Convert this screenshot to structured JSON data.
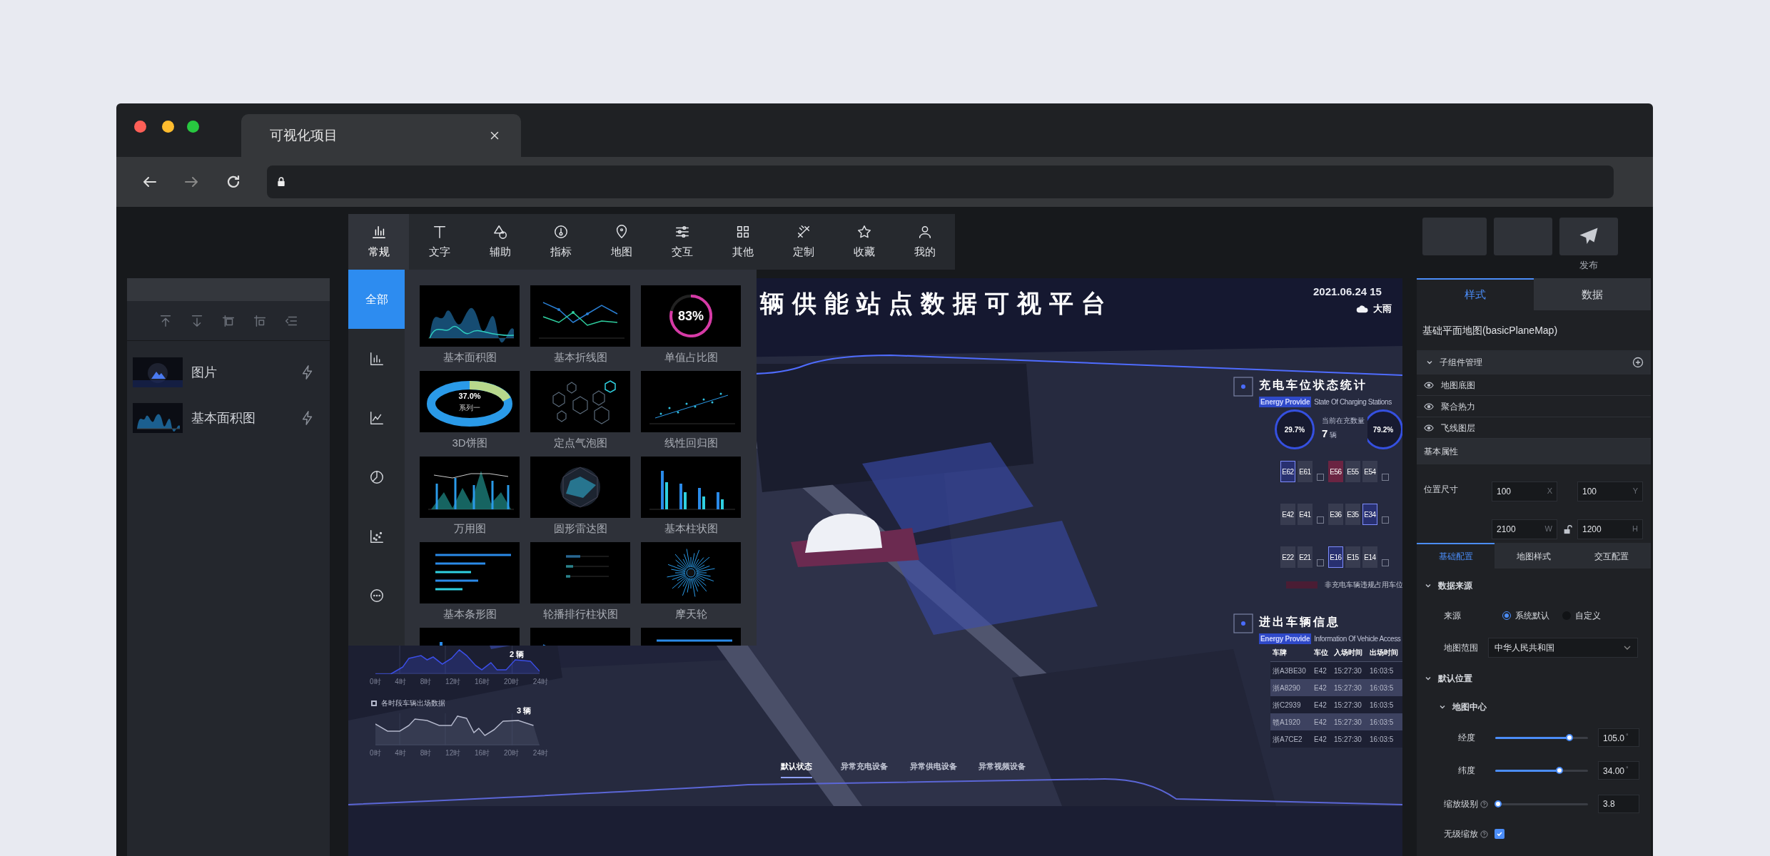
{
  "browser": {
    "tab_title": "可视化项目"
  },
  "toolbar": {
    "buttons": [
      {
        "kind": "blank"
      },
      {
        "kind": "blank"
      },
      {
        "kind": "publish",
        "label": "发布"
      }
    ]
  },
  "layers_panel": {
    "layers": [
      {
        "name": "图片"
      },
      {
        "name": "基本面积图",
        "kind": "area"
      }
    ]
  },
  "component_picker": {
    "tabs": [
      {
        "label": "常规",
        "kind": "common",
        "selected": true
      },
      {
        "label": "文字",
        "kind": "text",
        "selected": false
      },
      {
        "label": "辅助",
        "kind": "assist",
        "selected": false
      },
      {
        "label": "指标",
        "kind": "metric",
        "selected": false
      },
      {
        "label": "地图",
        "kind": "map",
        "selected": false
      },
      {
        "label": "交互",
        "kind": "interact",
        "selected": false
      },
      {
        "label": "其他",
        "kind": "other",
        "selected": false
      },
      {
        "label": "定制",
        "kind": "custom",
        "selected": false
      },
      {
        "label": "收藏",
        "kind": "favorite",
        "selected": false
      },
      {
        "label": "我的",
        "kind": "mine",
        "selected": false
      }
    ],
    "categories": [
      {
        "kind": "all",
        "label": "全部",
        "selected": true
      },
      {
        "kind": "bar",
        "selected": false
      },
      {
        "kind": "line",
        "selected": false
      },
      {
        "kind": "pie",
        "selected": false
      },
      {
        "kind": "scatter",
        "selected": false
      },
      {
        "kind": "more",
        "selected": false
      }
    ],
    "items": [
      {
        "label": "基本面积图",
        "kind": "area"
      },
      {
        "label": "基本折线图",
        "kind": "line"
      },
      {
        "label": "单值占比图",
        "kind": "ring",
        "value": "83%"
      },
      {
        "label": "3D饼图",
        "kind": "pie3d",
        "value": "37.0%",
        "series": "系列一"
      },
      {
        "label": "定点气泡图",
        "kind": "bubble"
      },
      {
        "label": "线性回归图",
        "kind": "scatter"
      },
      {
        "label": "万用图",
        "kind": "combo"
      },
      {
        "label": "圆形雷达图",
        "kind": "radar"
      },
      {
        "label": "基本柱状图",
        "kind": "column"
      },
      {
        "label": "基本条形图",
        "kind": "hbar"
      },
      {
        "label": "轮播排行柱状图",
        "kind": "rank"
      },
      {
        "label": "摩天轮",
        "kind": "wheel"
      },
      {
        "kind": "column"
      },
      {
        "kind": "line"
      },
      {
        "kind": "hbar"
      }
    ]
  },
  "dashboard": {
    "title": "辆供能站点数据可视平台",
    "datetime": "2021.06.24 15",
    "weather": "大雨",
    "charging": {
      "title": "充电车位状态统计",
      "tag": "Energy Provide",
      "subtitle": "State Of Charging Stations",
      "gauges": [
        {
          "text": "29.7%"
        },
        {
          "text": "79.2%"
        }
      ],
      "count_label": "当前在充数量",
      "count": "7",
      "count_unit": "辆",
      "slot_rows": [
        [
          {
            "kind": "slot",
            "label": "E62",
            "selected": true,
            "violation": false
          },
          {
            "kind": "slot",
            "label": "E61",
            "selected": false,
            "violation": false
          },
          {
            "kind": "marker"
          },
          {
            "kind": "slot",
            "label": "E56",
            "selected": false,
            "violation": true
          },
          {
            "kind": "slot",
            "label": "E55",
            "selected": false,
            "violation": false
          },
          {
            "kind": "slot",
            "label": "E54",
            "selected": false,
            "violation": false
          },
          {
            "kind": "marker"
          }
        ],
        [
          {
            "kind": "slot",
            "label": "E42",
            "selected": false,
            "violation": false
          },
          {
            "kind": "slot",
            "label": "E41",
            "selected": false,
            "violation": false
          },
          {
            "kind": "marker"
          },
          {
            "kind": "slot",
            "label": "E36",
            "selected": false,
            "violation": false
          },
          {
            "kind": "slot",
            "label": "E35",
            "selected": false,
            "violation": false
          },
          {
            "kind": "slot",
            "label": "E34",
            "selected": true,
            "violation": false
          },
          {
            "kind": "marker"
          }
        ],
        [
          {
            "kind": "slot",
            "label": "E22",
            "selected": false,
            "violation": false
          },
          {
            "kind": "slot",
            "label": "E21",
            "selected": false,
            "violation": false
          },
          {
            "kind": "marker"
          },
          {
            "kind": "slot",
            "label": "E16",
            "selected": true,
            "violation": false
          },
          {
            "kind": "slot",
            "label": "E15",
            "selected": false,
            "violation": false
          },
          {
            "kind": "slot",
            "label": "E14",
            "selected": false,
            "violation": false
          },
          {
            "kind": "marker"
          }
        ]
      ],
      "legend": "非充电车辆违规占用车位"
    },
    "vehicles": {
      "title": "进出车辆信息",
      "tag": "Energy Provide",
      "subtitle": "Information Of Vehicle Access",
      "columns": [
        "车牌",
        "车位",
        "入场时间",
        "出场时间"
      ],
      "rows": [
        {
          "cells": [
            "浙A3BE30",
            "E42",
            "15:27:30",
            "16:03:5"
          ],
          "highlighted": false
        },
        {
          "cells": [
            "浙A8290",
            "E42",
            "15:27:30",
            "16:03:5"
          ],
          "highlighted": true
        },
        {
          "cells": [
            "浙C2939",
            "E42",
            "15:27:30",
            "16:03:5"
          ],
          "highlighted": false
        },
        {
          "cells": [
            "赣A1920",
            "E42",
            "15:27:30",
            "16:03:5"
          ],
          "highlighted": true
        },
        {
          "cells": [
            "浙A7CE2",
            "E42",
            "15:27:30",
            "16:03:5"
          ],
          "highlighted": false
        }
      ]
    },
    "modes": [
      {
        "label": "默认状态",
        "selected": true
      },
      {
        "label": "异常充电设备",
        "selected": false
      },
      {
        "label": "异常供电设备",
        "selected": false
      },
      {
        "label": "异常视频设备",
        "selected": false
      }
    ],
    "mini_charts": [
      {
        "kind": "area",
        "color": "#3b4ee6",
        "value_label": "2 辆",
        "ticks": [
          "0时",
          "4时",
          "8时",
          "12时",
          "16时",
          "20时",
          "24时"
        ]
      },
      {
        "kind": "line",
        "color": "#b4b8cc",
        "legend": "各时段车辆出场数据",
        "value_label": "3 辆",
        "ticks": [
          "0时",
          "4时",
          "8时",
          "12时",
          "16时",
          "20时",
          "24时"
        ]
      }
    ]
  },
  "inspector": {
    "tabs": [
      {
        "label": "样式",
        "selected": true
      },
      {
        "label": "数据",
        "selected": false
      }
    ],
    "component_title": "基础平面地图(basicPlaneMap)",
    "subcomponents": {
      "title": "子组件管理",
      "expanded": true,
      "items": [
        {
          "label": "地图底图",
          "visible": true
        },
        {
          "label": "聚合热力",
          "visible": true
        },
        {
          "label": "飞线图层",
          "visible": true
        }
      ]
    },
    "basic_props": {
      "title": "基本属性",
      "position_label": "位置尺寸",
      "locked": false,
      "fields": [
        {
          "value": "100",
          "unit": "X"
        },
        {
          "value": "100",
          "unit": "Y"
        },
        {
          "value": "2100",
          "unit": "W"
        },
        {
          "value": "1200",
          "unit": "H"
        }
      ]
    },
    "config_tabs": [
      {
        "label": "基础配置",
        "selected": true
      },
      {
        "label": "地图样式",
        "selected": false
      },
      {
        "label": "交互配置",
        "selected": false
      }
    ],
    "data_source": {
      "title": "数据来源",
      "expanded": true,
      "source_label": "来源",
      "options": [
        {
          "label": "系统默认",
          "selected": true
        },
        {
          "label": "自定义",
          "selected": false
        }
      ],
      "range_label": "地图范围",
      "range_value": "中华人民共和国"
    },
    "default_position": {
      "title": "默认位置",
      "expanded": true,
      "center": {
        "title": "地图中心",
        "expanded": true,
        "sliders": [
          {
            "label": "经度",
            "level": 0.8,
            "value": "105.0",
            "unit": "°"
          },
          {
            "label": "纬度",
            "level": 0.69,
            "value": "34.00",
            "unit": "°"
          }
        ]
      },
      "zoom": {
        "label": "缩放级别",
        "level": 0.03,
        "value": "3.8"
      },
      "smooth_zoom": {
        "label": "无级缩放",
        "checked": true
      }
    }
  }
}
